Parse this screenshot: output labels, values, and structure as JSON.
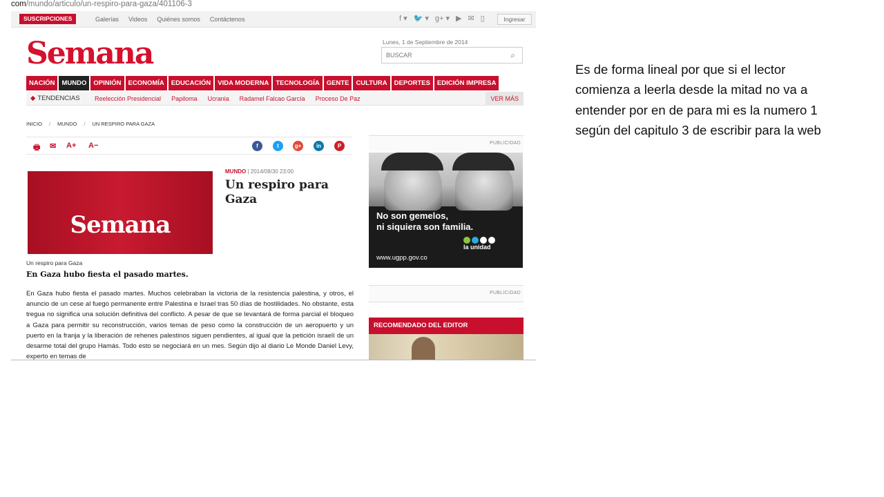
{
  "url": {
    "host": "na.com",
    "path": "/mundo/articulo/un-respiro-para-gaza/401106-3"
  },
  "topbar": {
    "subscriptions": "SUSCRIPCIONES",
    "links": [
      "Galerías",
      "Videos",
      "Quiénes somos",
      "Contáctenos"
    ],
    "login": "Ingresar"
  },
  "header": {
    "logo": "Semana",
    "date": "Lunes, 1 de Septiembre de 2014",
    "search_placeholder": "BUSCAR"
  },
  "nav": [
    "NACIÓN",
    "MUNDO",
    "OPINIÓN",
    "ECONOMÍA",
    "EDUCACIÓN",
    "VIDA MODERNA",
    "TECNOLOGÍA",
    "GENTE",
    "CULTURA",
    "DEPORTES",
    "EDICIÓN IMPRESA"
  ],
  "trends": {
    "label": "TENDENCIAS",
    "items": [
      "Reelección Presidencial",
      "Papiloma",
      "Ucrania",
      "Radamel Falcao García",
      "Proceso De Paz"
    ],
    "more": "VER MÁS"
  },
  "breadcrumb": [
    "INICIO",
    "MUNDO",
    "UN RESPIRO PARA GAZA"
  ],
  "tools": {
    "print": "🖶",
    "mail": "✉",
    "font_up": "A+",
    "font_down": "A−"
  },
  "article": {
    "section": "MUNDO",
    "datetime": "| 2014/08/30 23:00",
    "title": "Un respiro para Gaza",
    "hero_logo": "Semana",
    "caption": "Un respiro para Gaza",
    "subtitle": "En Gaza hubo fiesta el pasado martes.",
    "body": "En Gaza hubo fiesta el pasado martes. Muchos celebraban la victoria de la resistencia palestina, y otros, el anuncio de un cese al fuego permanente entre Palestina e Israel tras 50 días de hostilidades. No obstante, esta tregua no significa una solución definitiva del conflicto. A pesar de que se levantará de forma parcial el bloqueo a Gaza para permitir su reconstrucción, varios temas de peso como la construcción de un aeropuerto y un puerto en la franja y la liberación de rehenes palestinos siguen pendientes, al igual que la petición israelí de un desarme total del grupo Hamás. Todo esto se negociará en un mes. Según dijo al diario Le Monde Daniel Levy, experto en temas de"
  },
  "sidebar": {
    "ad_label": "PUBLICIDAD",
    "ad_line1": "No son gemelos,",
    "ad_line2": "ni siquiera son familia.",
    "ad_url": "www.ugpp.gov.co",
    "ad_brand": "la unidad",
    "ad_label_2": "PUBLICIDAD",
    "recommended": "RECOMENDADO DEL EDITOR"
  },
  "colors": {
    "brand_red": "#c8102e",
    "dark": "#222222"
  },
  "note": "Es de forma lineal por que si el lector comienza a leerla desde la mitad no va a entender  por en de para mi es la numero 1 según del capitulo 3 de escribir para la web"
}
